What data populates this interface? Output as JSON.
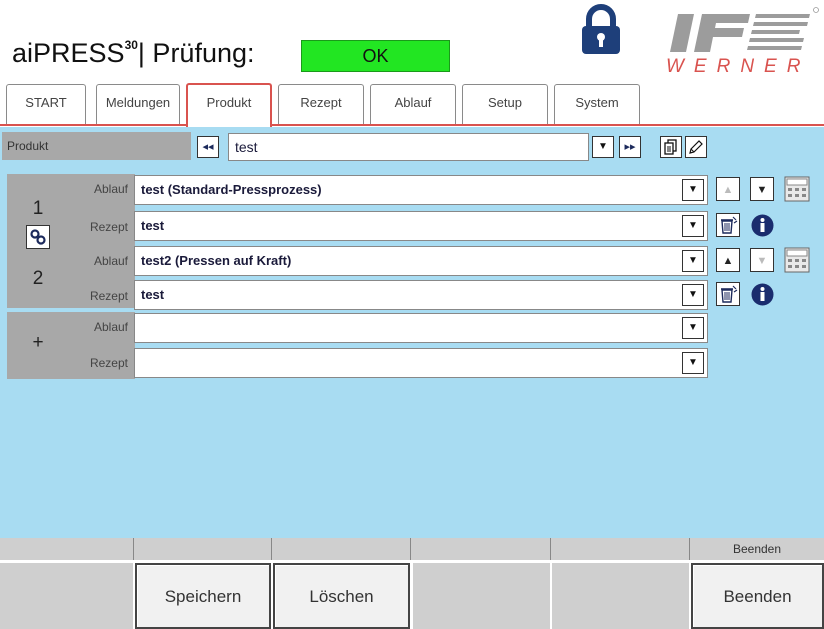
{
  "header": {
    "app_name": "aiPRESS",
    "app_sup": "30",
    "label": "| Prüfung:",
    "status": "OK",
    "logo_text": "WERNER",
    "status_color": "#22e622",
    "lock_color": "#1e3f7a"
  },
  "tabs": [
    {
      "label": "START",
      "active": false
    },
    {
      "label": "Meldungen",
      "active": false
    },
    {
      "label": "Produkt",
      "active": true
    },
    {
      "label": "Rezept",
      "active": false
    },
    {
      "label": "Ablauf",
      "active": false
    },
    {
      "label": "Setup",
      "active": false
    },
    {
      "label": "System",
      "active": false
    }
  ],
  "product": {
    "label": "Produkt",
    "value": "test",
    "prev_icon": "double-left-arrow-icon",
    "next_icon": "double-right-arrow-icon"
  },
  "steps": [
    {
      "number": "1",
      "ablauf_label": "Ablauf",
      "ablauf_value": "test (Standard-Pressprozess)",
      "rezept_label": "Rezept",
      "rezept_value": "test"
    },
    {
      "number": "2",
      "ablauf_label": "Ablauf",
      "ablauf_value": "test2 (Pressen auf Kraft)",
      "rezept_label": "Rezept",
      "rezept_value": "test"
    }
  ],
  "new_step": {
    "symbol": "+",
    "ablauf_label": "Ablauf",
    "ablauf_value": "",
    "rezept_label": "Rezept",
    "rezept_value": ""
  },
  "footer": {
    "bar_top_label": "Beenden",
    "buttons": [
      {
        "label": ""
      },
      {
        "label": "Speichern"
      },
      {
        "label": "Löschen"
      },
      {
        "label": ""
      },
      {
        "label": ""
      },
      {
        "label": "Beenden"
      }
    ]
  },
  "colors": {
    "panel_bg": "#a8dcf2",
    "tab_active_border": "#d9534f",
    "row_label_bg": "#a8a8a8"
  }
}
